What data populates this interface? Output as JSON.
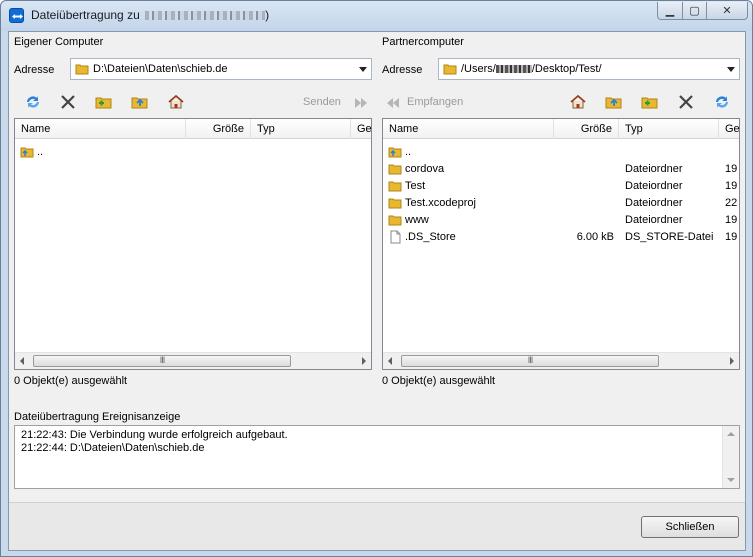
{
  "window": {
    "title": "Dateiübertragung zu"
  },
  "local": {
    "section_label": "Eigener Computer",
    "address_label": "Adresse",
    "address_value": "D:\\Dateien\\Daten\\schieb.de",
    "send_label": "Senden",
    "columns": [
      "Name",
      "Größe",
      "Typ",
      "Ge"
    ],
    "rows": [
      {
        "name": "..",
        "size": "",
        "type": "",
        "date": ""
      }
    ],
    "status": "0 Objekt(e) ausgewählt"
  },
  "remote": {
    "section_label": "Partnercomputer",
    "address_label": "Adresse",
    "address_prefix": "/Users/",
    "address_suffix": "/Desktop/Test/",
    "receive_label": "Empfangen",
    "columns": [
      "Name",
      "Größe",
      "Typ",
      "Ge"
    ],
    "rows": [
      {
        "name": "..",
        "size": "",
        "type": "",
        "date": "",
        "icon": "parent-folder-icon"
      },
      {
        "name": "cordova",
        "size": "",
        "type": "Dateiordner",
        "date": "19",
        "icon": "folder-icon"
      },
      {
        "name": "Test",
        "size": "",
        "type": "Dateiordner",
        "date": "19",
        "icon": "folder-icon"
      },
      {
        "name": "Test.xcodeproj",
        "size": "",
        "type": "Dateiordner",
        "date": "22",
        "icon": "folder-icon"
      },
      {
        "name": "www",
        "size": "",
        "type": "Dateiordner",
        "date": "19",
        "icon": "folder-icon"
      },
      {
        "name": ".DS_Store",
        "size": "6.00 kB",
        "type": "DS_STORE-Datei",
        "date": "19",
        "icon": "file-icon"
      }
    ],
    "status": "0 Objekt(e) ausgewählt"
  },
  "log": {
    "label": "Dateiübertragung Ereignisanzeige",
    "lines": [
      "21:22:43: Die Verbindung wurde erfolgreich aufgebaut.",
      "21:22:44: D:\\Dateien\\Daten\\schieb.de"
    ]
  },
  "footer": {
    "close_label": "Schließen"
  },
  "colors": {
    "titlebar": "#c9d9ec",
    "folder": "#e8b830",
    "selection_blue": "#0e6dd8"
  }
}
